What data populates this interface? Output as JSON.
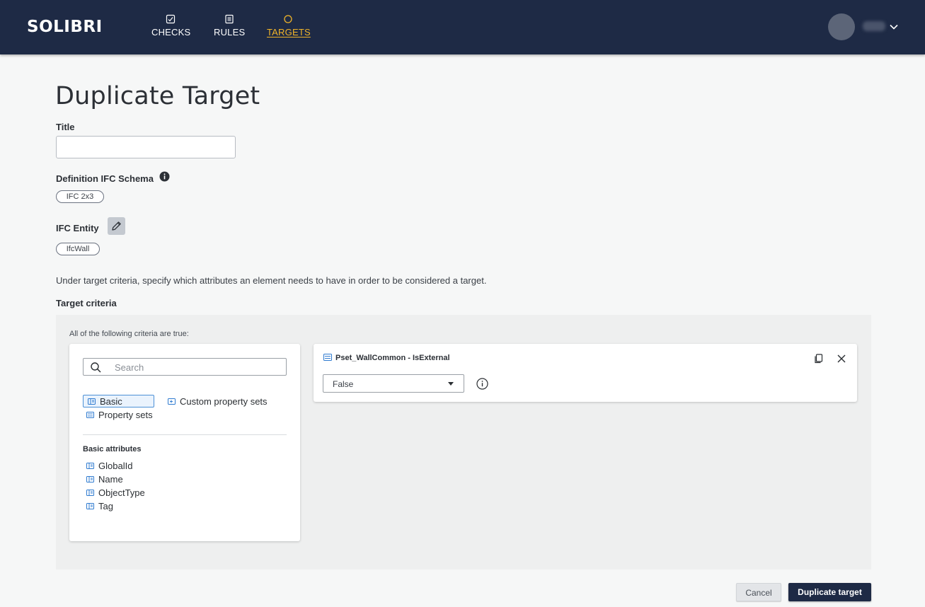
{
  "header": {
    "logo": "SOLIBRI",
    "nav": [
      {
        "label": "CHECKS",
        "icon": "checks-icon"
      },
      {
        "label": "RULES",
        "icon": "rules-icon"
      },
      {
        "label": "TARGETS",
        "icon": "targets-icon",
        "active": true
      }
    ],
    "accent_color": "#f0b429",
    "background_color": "#1e2a45"
  },
  "page": {
    "title": "Duplicate Target",
    "title_field_label": "Title",
    "title_value": "",
    "schema_label": "Definition IFC Schema",
    "schema_value": "IFC 2x3",
    "entity_label": "IFC Entity",
    "entity_value": "IfcWall",
    "help_text": "Under target criteria, specify which attributes an element needs to have in order to be considered a target.",
    "criteria_label": "Target criteria"
  },
  "criteria": {
    "note": "All of the following criteria are true:",
    "search_placeholder": "Search",
    "categories": [
      "Basic",
      "Custom property sets",
      "Property sets"
    ],
    "basic_heading": "Basic attributes",
    "basic_attributes": [
      "GlobalId",
      "Name",
      "ObjectType",
      "Tag"
    ],
    "card": {
      "title": "Pset_WallCommon - IsExternal",
      "value": "False"
    }
  },
  "footer": {
    "cancel_label": "Cancel",
    "submit_label": "Duplicate target"
  }
}
